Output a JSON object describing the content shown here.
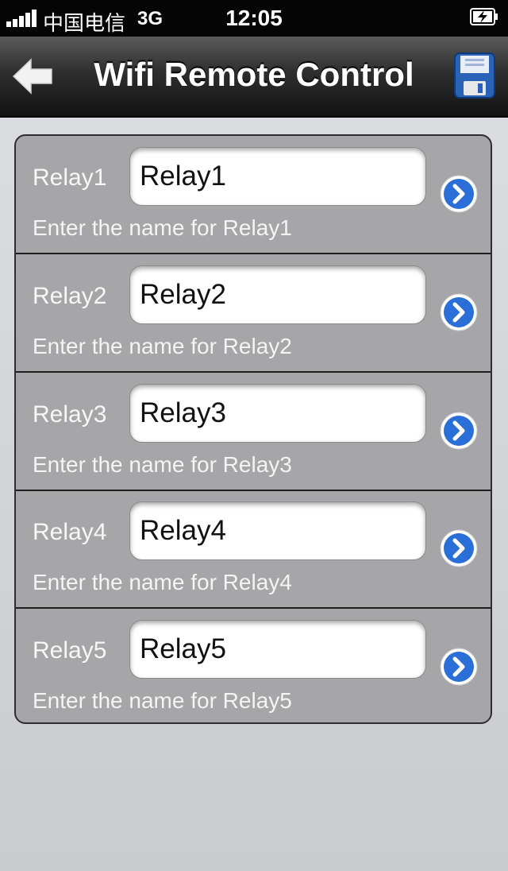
{
  "status_bar": {
    "carrier": "中国电信",
    "network": "3G",
    "time": "12:05",
    "signal_icon": "signal-bars-icon",
    "battery_icon": "battery-charging-icon"
  },
  "nav_bar": {
    "title": "Wifi Remote Control",
    "back_icon": "back-arrow-icon",
    "save_icon": "floppy-disk-icon"
  },
  "relays": [
    {
      "label": "Relay1",
      "value": "Relay1",
      "hint": "Enter the name for Relay1"
    },
    {
      "label": "Relay2",
      "value": "Relay2",
      "hint": "Enter the name for Relay2"
    },
    {
      "label": "Relay3",
      "value": "Relay3",
      "hint": "Enter the name for Relay3"
    },
    {
      "label": "Relay4",
      "value": "Relay4",
      "hint": "Enter the name for Relay4"
    },
    {
      "label": "Relay5",
      "value": "Relay5",
      "hint": "Enter the name for Relay5"
    }
  ],
  "colors": {
    "status_bar": "#050505",
    "nav_bar": "#2e2e2e",
    "table_bg": "#a6a6a8",
    "disclosure_blue": "#2a6ed8"
  }
}
